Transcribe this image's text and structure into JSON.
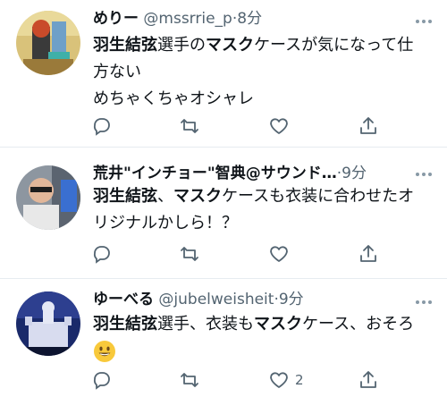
{
  "tweets": [
    {
      "name": "めりー",
      "handle": "@mssrrie_p",
      "time": "8分",
      "lines": [
        [
          {
            "t": "羽生結弦",
            "b": true
          },
          {
            "t": "選手の",
            "b": false
          },
          {
            "t": "マスク",
            "b": true
          },
          {
            "t": "ケースが気になって仕",
            "b": false
          }
        ],
        [
          {
            "t": "方ない",
            "b": false
          }
        ],
        [
          {
            "t": "めちゃくちゃオシャレ",
            "b": false
          }
        ]
      ],
      "like_count": ""
    },
    {
      "name": "荒井\"インチョー\"智典@サウンド…",
      "handle": "",
      "time": "9分",
      "lines": [
        [
          {
            "t": "羽生結弦",
            "b": true
          },
          {
            "t": "、",
            "b": false
          },
          {
            "t": "マスク",
            "b": true
          },
          {
            "t": "ケースも衣装に合わせたオ",
            "b": false
          }
        ],
        [
          {
            "t": "リジナルかしら！？",
            "b": false
          }
        ]
      ],
      "like_count": ""
    },
    {
      "name": "ゆーべる",
      "handle": "@jubelweisheit",
      "time": "9分",
      "lines": [
        [
          {
            "t": "羽生結弦",
            "b": true
          },
          {
            "t": "選手、衣装も",
            "b": false
          },
          {
            "t": "マスク",
            "b": true
          },
          {
            "t": "ケース、おそろ",
            "b": false
          }
        ],
        [
          {
            "t": "[emoji]",
            "b": false
          }
        ]
      ],
      "like_count": "2"
    }
  ],
  "icons": [
    "reply-icon",
    "retweet-icon",
    "like-icon",
    "share-icon",
    "more-icon",
    "smile-emoji"
  ],
  "colors": {
    "icon": "#536471",
    "divider": "#e6ecf0",
    "text": "#0f1419"
  }
}
